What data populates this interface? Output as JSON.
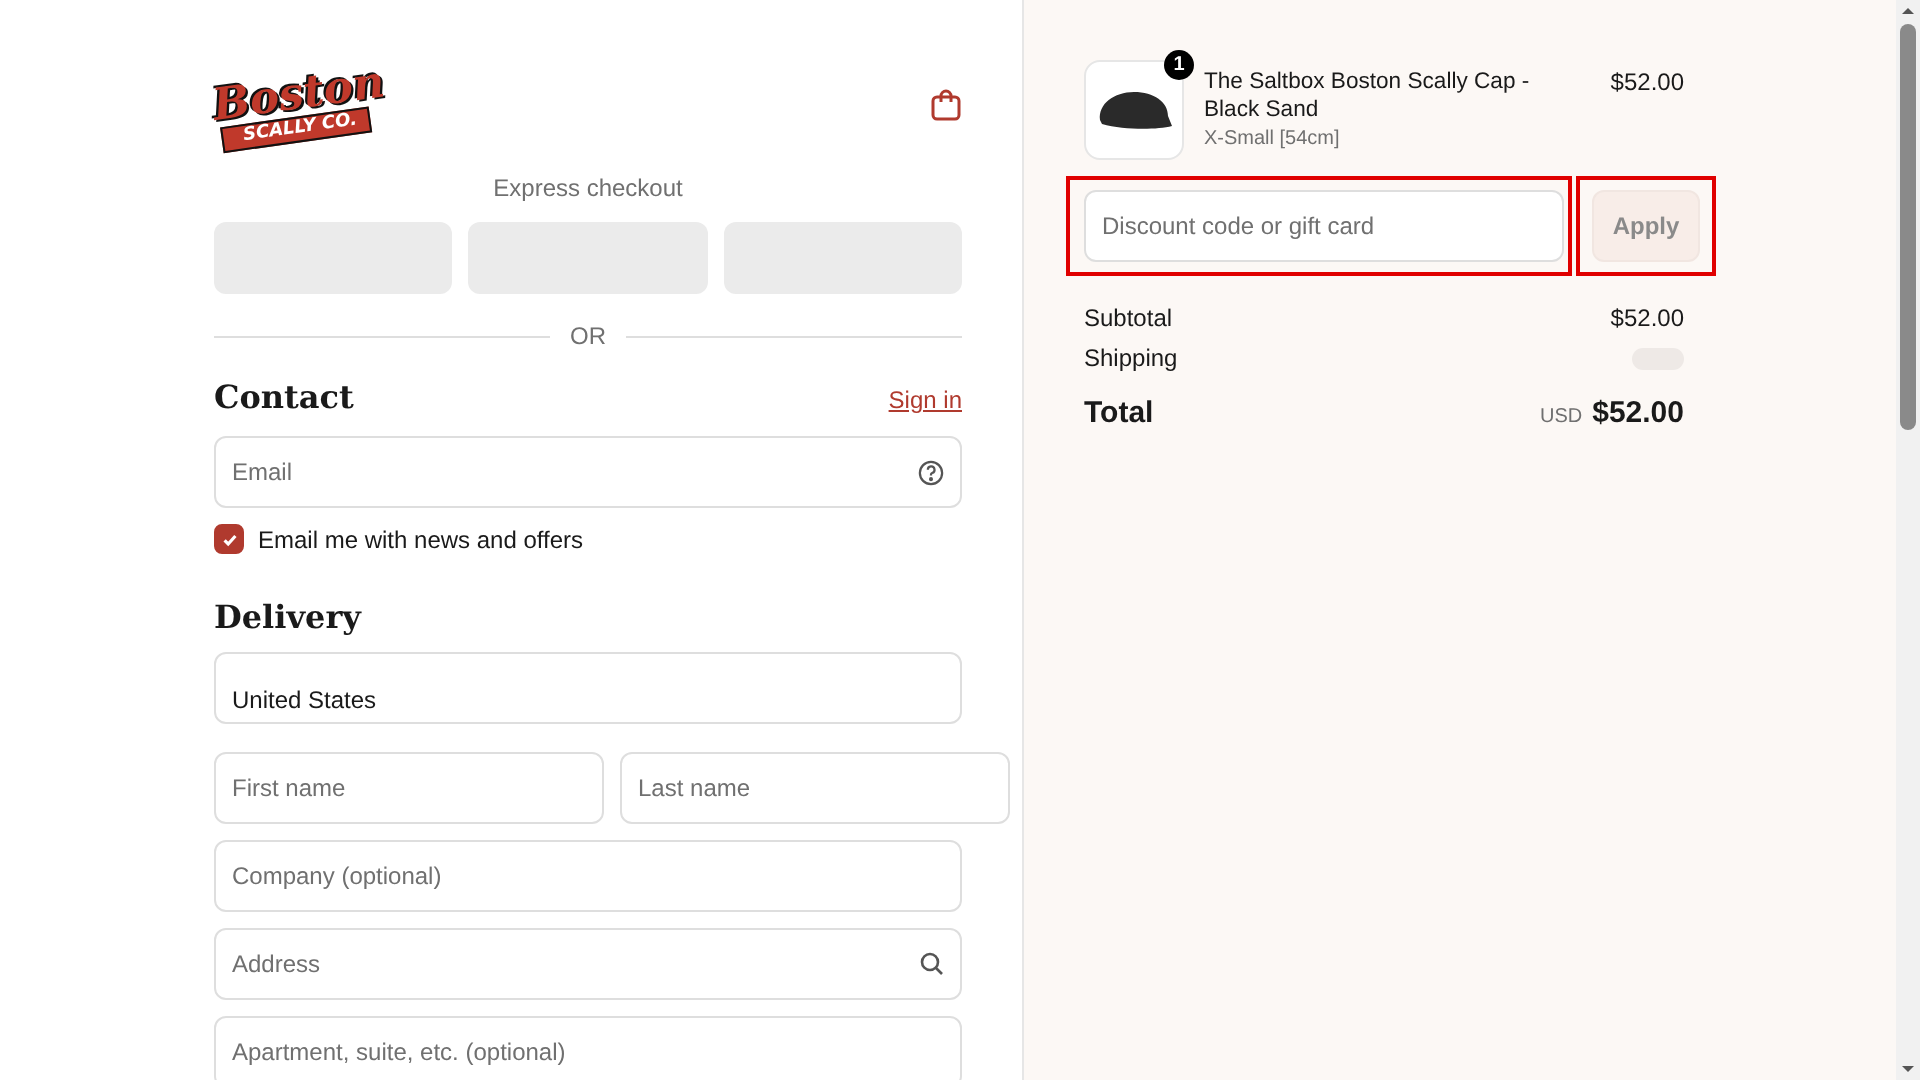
{
  "logo": {
    "title": "Boston",
    "subtitle": "SCALLY CO."
  },
  "express_checkout": {
    "label": "Express checkout",
    "divider": "OR"
  },
  "contact": {
    "heading": "Contact",
    "sign_in": "Sign in",
    "email": {
      "placeholder": "Email"
    },
    "newsletter": {
      "label": "Email me with news and offers",
      "checked": true
    }
  },
  "delivery": {
    "heading": "Delivery",
    "country": {
      "value": "United States"
    },
    "fields": [
      {
        "row": [
          {
            "placeholder": "First name"
          },
          {
            "placeholder": "Last name"
          }
        ]
      },
      {
        "row": [
          {
            "placeholder": "Company (optional)"
          }
        ]
      },
      {
        "row": [
          {
            "placeholder": "Address",
            "kind": "search"
          }
        ]
      },
      {
        "row": [
          {
            "placeholder": "Apartment, suite, etc. (optional)"
          }
        ]
      }
    ]
  },
  "order": {
    "item": {
      "name": "The Saltbox Boston Scally Cap - Black Sand",
      "variant": "X-Small [54cm]",
      "price": "$52.00",
      "quantity": "1"
    },
    "discount": {
      "placeholder": "Discount code or gift card",
      "button": "Apply",
      "highlighted": true
    },
    "subtotal": {
      "label": "Subtotal",
      "value": "$52.00"
    },
    "shipping": {
      "label": "Shipping"
    },
    "total": {
      "label": "Total",
      "currency": "USD",
      "value": "$52.00"
    }
  }
}
